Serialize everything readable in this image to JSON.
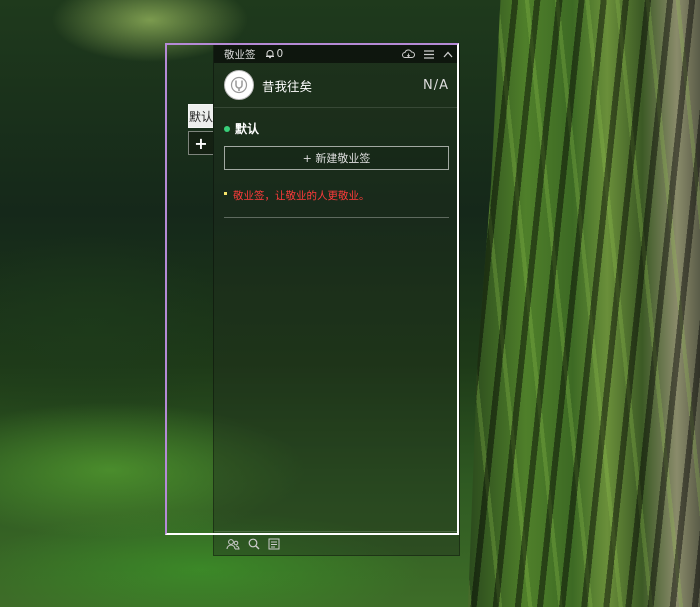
{
  "window": {
    "title": "敬业签",
    "notification_count": "0"
  },
  "user": {
    "name": "昔我往矣",
    "status": "N/A"
  },
  "side_tabs": [
    {
      "label": "默认"
    },
    {
      "label": "+"
    }
  ],
  "group": {
    "title": "默认",
    "new_note_label": "+ 新建敬业签"
  },
  "notes": [
    {
      "text": "敬业签，让敬业的人更敬业。"
    }
  ],
  "icons": {
    "bell": "bell-icon",
    "cloud": "cloud-sync-icon",
    "menu": "menu-icon",
    "collapse": "chevron-up-icon",
    "contacts": "contacts-icon",
    "search": "search-icon",
    "list": "list-icon"
  },
  "colors": {
    "group_dot": "#39d07a",
    "note_text": "#ff3b3b",
    "selection_left": "#b58ad6"
  }
}
